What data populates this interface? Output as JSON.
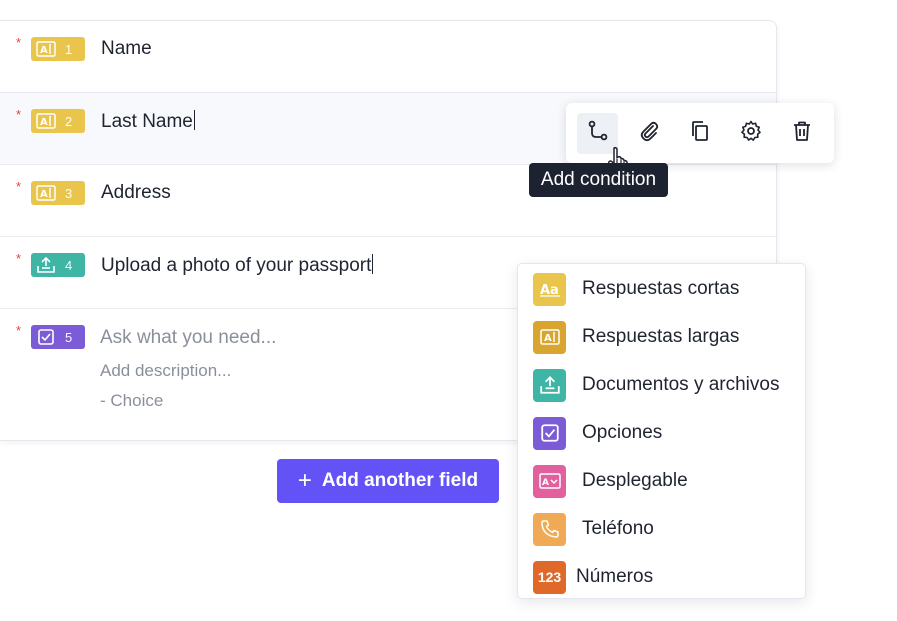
{
  "fields": [
    {
      "label": "Name",
      "number": "1",
      "required_mark": "*",
      "icon": "long-text-icon",
      "color": "#e9c54b"
    },
    {
      "label": "Last Name",
      "number": "2",
      "required_mark": "*",
      "icon": "long-text-icon",
      "color": "#e9c54b"
    },
    {
      "label": "Address",
      "number": "3",
      "required_mark": "*",
      "icon": "long-text-icon",
      "color": "#e9c54b"
    },
    {
      "label": "Upload a photo of your passport",
      "number": "4",
      "required_mark": "*",
      "icon": "upload-icon",
      "color": "#3fb5a6"
    },
    {
      "number": "5",
      "required_mark": "*",
      "icon": "checkbox-icon",
      "color": "#7c5cd6",
      "question_placeholder": "Ask what you need...",
      "description_placeholder": "Add description...",
      "choice_placeholder": "- Choice"
    }
  ],
  "toolbar": {
    "buttons": [
      "branch-icon",
      "paperclip-icon",
      "copy-icon",
      "gear-icon",
      "trash-icon"
    ],
    "tooltip": "Add condition"
  },
  "add_field_button": {
    "icon": "plus",
    "label": "Add another field",
    "color": "#6352f5"
  },
  "type_menu": {
    "items": [
      {
        "label": "Respuestas cortas",
        "icon": "short-text-icon",
        "color": "#e9c54b"
      },
      {
        "label": "Respuestas largas",
        "icon": "long-text-icon",
        "color": "#d9a52f"
      },
      {
        "label": "Documentos y archivos",
        "icon": "upload-icon",
        "color": "#3fb5a6"
      },
      {
        "label": "Opciones",
        "icon": "checkbox-icon",
        "color": "#7c5cd6"
      },
      {
        "label": "Desplegable",
        "icon": "dropdown-icon",
        "color": "#e3609e"
      },
      {
        "label": "Teléfono",
        "icon": "phone-icon",
        "color": "#f0aa55"
      },
      {
        "label": "Números",
        "icon": "numbers-icon",
        "icon_text": "123",
        "color": "#e0692a"
      }
    ]
  }
}
